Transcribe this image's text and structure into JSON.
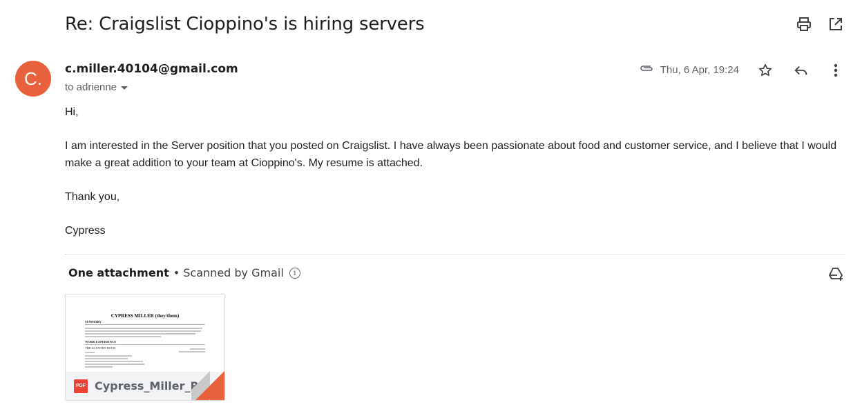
{
  "email": {
    "subject": "Re: Craigslist Cioppino's is hiring servers",
    "sender_initial": "C.",
    "sender_email": "c.miller.40104@gmail.com",
    "recipient": "to adrienne",
    "date": "Thu, 6 Apr, 19:24",
    "body": {
      "greeting": "Hi,",
      "paragraph": "I am interested in the Server position that you posted on Craigslist. I have always been passionate about food and customer service, and I believe that I would make a great addition to your team at Cioppino's. My resume is attached.",
      "closing": "Thank you,",
      "signature": "Cypress"
    }
  },
  "attachments": {
    "count_label": "One attachment",
    "scanned_label": "• Scanned by Gmail",
    "file": {
      "type_badge": "PDF",
      "name": "Cypress_Miller_R...",
      "preview_title": "CYPRESS MILLER (they/them)",
      "preview_sections": [
        "SUMMARY",
        "WORK EXPERIENCE",
        "THE SLANTED DOOR"
      ]
    }
  },
  "icons": {
    "print": "print-icon",
    "open_new_window": "open-in-new-icon",
    "attachment": "paperclip-icon",
    "star": "star-icon",
    "reply": "reply-icon",
    "more": "more-vert-icon",
    "info": "info-icon",
    "add_to_drive": "add-to-drive-icon"
  },
  "colors": {
    "avatar": "#e8613d",
    "pdf_badge": "#ea4335"
  }
}
